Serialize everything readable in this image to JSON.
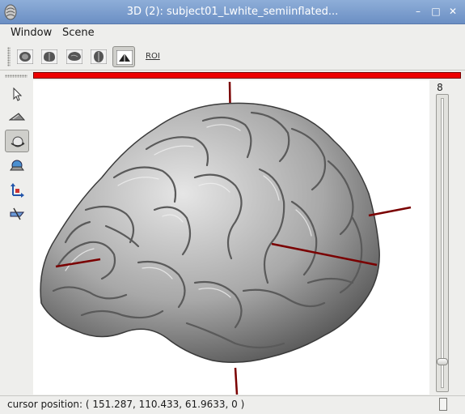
{
  "window": {
    "title": "3D (2): subject01_Lwhite_semiinflated..."
  },
  "menubar": {
    "items": [
      {
        "label": "Window"
      },
      {
        "label": "Scene"
      }
    ]
  },
  "toolbar": {
    "view_buttons": [
      {
        "icon": "brain-axial-view-icon"
      },
      {
        "icon": "brain-coronal-view-icon"
      },
      {
        "icon": "brain-sagittal-view-icon"
      },
      {
        "icon": "brain-axial-alt-view-icon"
      },
      {
        "icon": "3d-view-icon",
        "active": true
      }
    ],
    "roi_label": "ROI"
  },
  "left_tools": [
    {
      "icon": "pointer-icon"
    },
    {
      "icon": "plane-icon"
    },
    {
      "icon": "trackball-rotate-icon",
      "active": true
    },
    {
      "icon": "flight-control-icon"
    },
    {
      "icon": "translate-axes-icon"
    },
    {
      "icon": "slice-cut-icon"
    }
  ],
  "slider": {
    "value_label": "8",
    "position": 0.08
  },
  "status": {
    "cursor_text": "cursor position: ( 151.287, 110.433, 61.9633, 0 )"
  },
  "colors": {
    "accent_red": "#ee0000",
    "cursor_line": "#7a0000",
    "brain_gray": "#9a9a9a"
  }
}
